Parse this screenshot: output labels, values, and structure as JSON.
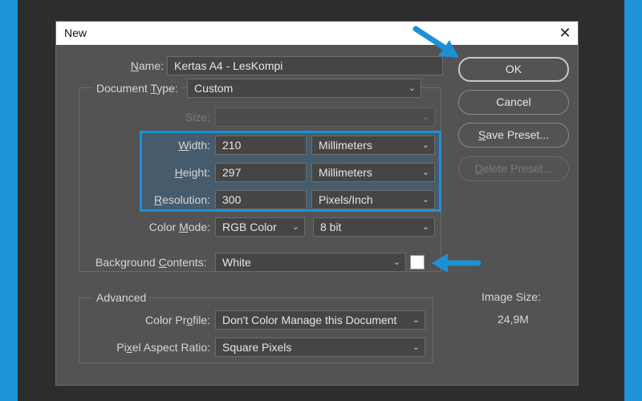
{
  "dialog": {
    "title": "New",
    "close_glyph": "✕"
  },
  "name": {
    "label": "Name:",
    "value": "Kertas A4 - LesKompi"
  },
  "document_type": {
    "label": "Document Type:",
    "value": "Custom"
  },
  "size": {
    "label": "Size:",
    "value": ""
  },
  "width": {
    "label": "Width:",
    "value": "210",
    "unit": "Millimeters"
  },
  "height": {
    "label": "Height:",
    "value": "297",
    "unit": "Millimeters"
  },
  "resolution": {
    "label": "Resolution:",
    "value": "300",
    "unit": "Pixels/Inch"
  },
  "color_mode": {
    "label": "Color Mode:",
    "value": "RGB Color",
    "bits": "8 bit"
  },
  "background": {
    "label": "Background Contents:",
    "value": "White",
    "swatch_color": "#ffffff"
  },
  "advanced": {
    "legend": "Advanced",
    "color_profile": {
      "label": "Color Profile:",
      "value": "Don't Color Manage this Document"
    },
    "pixel_aspect": {
      "label": "Pixel Aspect Ratio:",
      "value": "Square Pixels"
    }
  },
  "buttons": {
    "ok": "OK",
    "cancel": "Cancel",
    "save_preset": "Save Preset...",
    "delete_preset": "Delete Preset..."
  },
  "image_size": {
    "label": "Image Size:",
    "value": "24,9M"
  },
  "colors": {
    "highlight": "#1e90d6",
    "frame": "#1f93d9"
  }
}
